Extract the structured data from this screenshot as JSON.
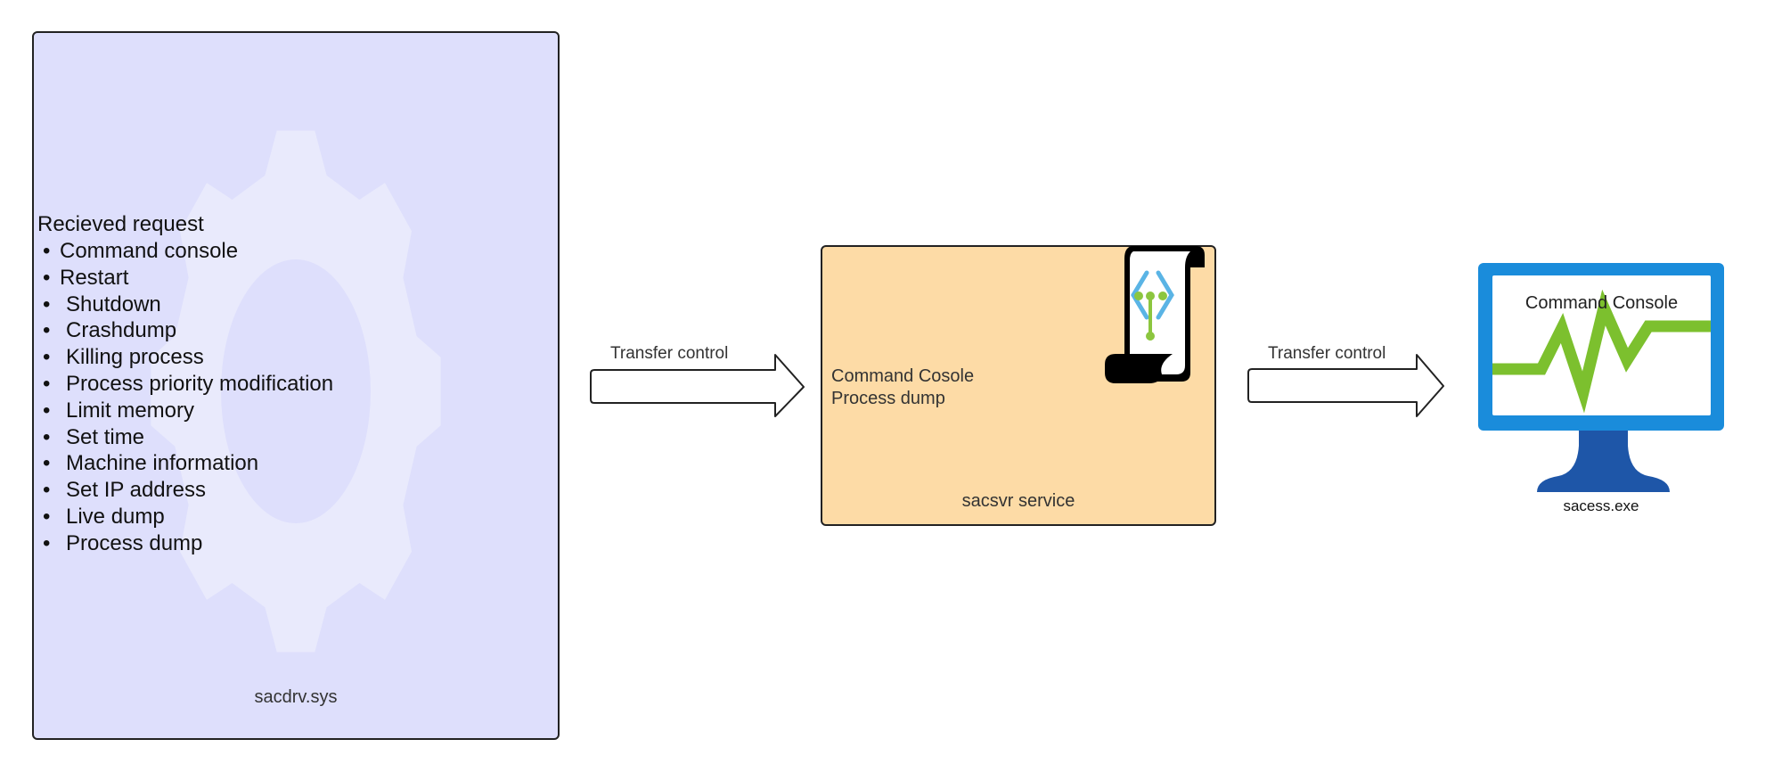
{
  "colors": {
    "driver_fill": "#DEDFFC",
    "driver_gear": "#E9EAFC",
    "service_fill": "#FDDBA6",
    "border": "#222222",
    "monitor_frame": "#1A8CDB",
    "monitor_stand": "#1E56A8",
    "monitor_graph": "#7CC02E",
    "scroll_bracket": "#5AB4E5",
    "scroll_node": "#8CC63F"
  },
  "driver": {
    "title": "Recieved request",
    "items": [
      "Command console",
      "Restart",
      "Shutdown",
      "Crashdump",
      "Killing process",
      "Process priority modification",
      "Limit memory",
      "Set time",
      "Machine information",
      "Set IP address",
      "Live dump",
      "Process dump"
    ],
    "bullet": "•",
    "name": "sacdrv.sys",
    "icon": "gear-icon"
  },
  "arrows": [
    {
      "label": "Transfer control"
    },
    {
      "label": "Transfer control"
    }
  ],
  "service": {
    "lines": [
      "Command Cosole",
      "Process dump"
    ],
    "name": "sacsvr service",
    "icon": "script-scroll-icon"
  },
  "client": {
    "screen_label": "Command Console",
    "name": "sacess.exe",
    "icon": "monitor-icon"
  }
}
